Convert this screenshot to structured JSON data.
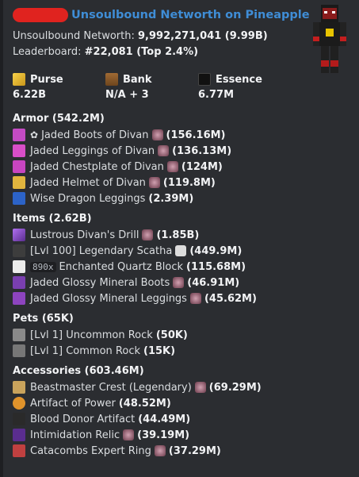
{
  "header": {
    "title": "Unsoulbound Networth on Pineapple"
  },
  "summary": {
    "networth_label": "Unsoulbound Networth:",
    "networth_value": "9,992,271,041 (9.99B)",
    "leaderboard_label": "Leaderboard:",
    "leaderboard_value": "#22,081 (Top 2.4%)"
  },
  "stats": [
    {
      "label": "Purse",
      "value": "6.22B",
      "icon": "gold-coins-icon",
      "color": "#f4c430"
    },
    {
      "label": "Bank",
      "value": "N/A + 3",
      "icon": "chest-icon",
      "color": "#8a5a2b"
    },
    {
      "label": "Essence",
      "value": "6.77M",
      "icon": "essence-icon",
      "color": "#202020"
    }
  ],
  "armor": {
    "title": "Armor (542.2M)",
    "items": [
      {
        "prefix": "✿",
        "name": "Jaded Boots of Divan",
        "value": "(156.16M)",
        "color": "#c44bc4",
        "gem": true
      },
      {
        "prefix": "",
        "name": "Jaded Leggings of Divan",
        "value": "(136.13M)",
        "color": "#d84ec8",
        "gem": true
      },
      {
        "prefix": "",
        "name": "Jaded Chestplate of Divan",
        "value": "(124M)",
        "color": "#c845c0",
        "gem": true
      },
      {
        "prefix": "",
        "name": "Jaded Helmet of Divan",
        "value": "(119.8M)",
        "color": "#e1b53e",
        "gem": true
      },
      {
        "prefix": "",
        "name": "Wise Dragon Leggings",
        "value": "(2.39M)",
        "color": "#2c63c8",
        "gem": false
      }
    ]
  },
  "items": {
    "title": "Items (2.62B)",
    "items": [
      {
        "badge": "",
        "name": "Lustrous Divan's Drill",
        "value": "(1.85B)",
        "color": "#9050d0",
        "gem": true
      },
      {
        "badge": "",
        "name": "[Lvl 100] Legendary Scatha",
        "value": "(449.9M)",
        "color": "#444444",
        "gem": true
      },
      {
        "badge": "890x",
        "name": "Enchanted Quartz Block",
        "value": "(115.68M)",
        "color": "#e6e6e6",
        "gem": false
      },
      {
        "badge": "",
        "name": "Jaded Glossy Mineral Boots",
        "value": "(46.91M)",
        "color": "#7a3fb0",
        "gem": true
      },
      {
        "badge": "",
        "name": "Jaded Glossy Mineral Leggings",
        "value": "(45.62M)",
        "color": "#8d44bf",
        "gem": true
      }
    ]
  },
  "pets": {
    "title": "Pets (65K)",
    "items": [
      {
        "name": "[Lvl 1] Uncommon Rock",
        "value": "(50K)",
        "color": "#888888"
      },
      {
        "name": "[Lvl 1] Common Rock",
        "value": "(15K)",
        "color": "#777777"
      }
    ]
  },
  "accessories": {
    "title": "Accessories (603.46M)",
    "items": [
      {
        "name": "Beastmaster Crest (Legendary)",
        "value": "(69.29M)",
        "color": "#c9a35c",
        "gem": true
      },
      {
        "name": "Artifact of Power",
        "value": "(48.52M)",
        "color": "#e0932b",
        "gem": false
      },
      {
        "name": "Blood Donor Artifact",
        "value": "(44.49M)",
        "color": "#3a3a3a",
        "gem": false
      },
      {
        "name": "Intimidation Relic",
        "value": "(39.19M)",
        "color": "#5a2d8f",
        "gem": true
      },
      {
        "name": "Catacombs Expert Ring",
        "value": "(37.29M)",
        "color": "#c04040",
        "gem": true
      }
    ]
  }
}
